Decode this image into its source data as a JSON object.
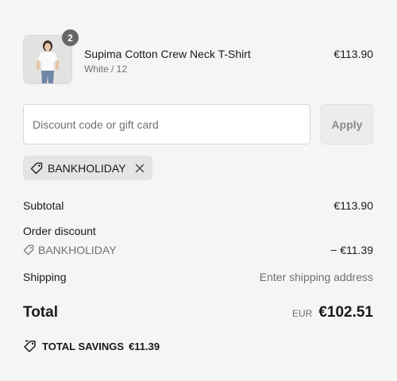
{
  "product": {
    "name": "Supima Cotton Crew Neck T-Shirt",
    "variant": "White / 12",
    "price": "€113.90",
    "quantity": "2",
    "image_alt": "Model wearing white t-shirt"
  },
  "discount": {
    "placeholder": "Discount code or gift card",
    "value": "",
    "apply_label": "Apply",
    "applied_code": "BANKHOLIDAY"
  },
  "summary": {
    "subtotal_label": "Subtotal",
    "subtotal_value": "€113.90",
    "order_discount_label": "Order discount",
    "discount_code": "BANKHOLIDAY",
    "discount_value": "− €11.39",
    "shipping_label": "Shipping",
    "shipping_value": "Enter shipping address",
    "total_label": "Total",
    "currency": "EUR",
    "total_value": "€102.51",
    "savings_label": "TOTAL SAVINGS",
    "savings_value": "€11.39"
  },
  "colors": {
    "background": "#f5f5f5",
    "text": "#1a1a1a",
    "muted": "#707070",
    "badge": "#666666"
  },
  "icons": [
    "tag-icon",
    "close-icon",
    "tags-icon"
  ]
}
